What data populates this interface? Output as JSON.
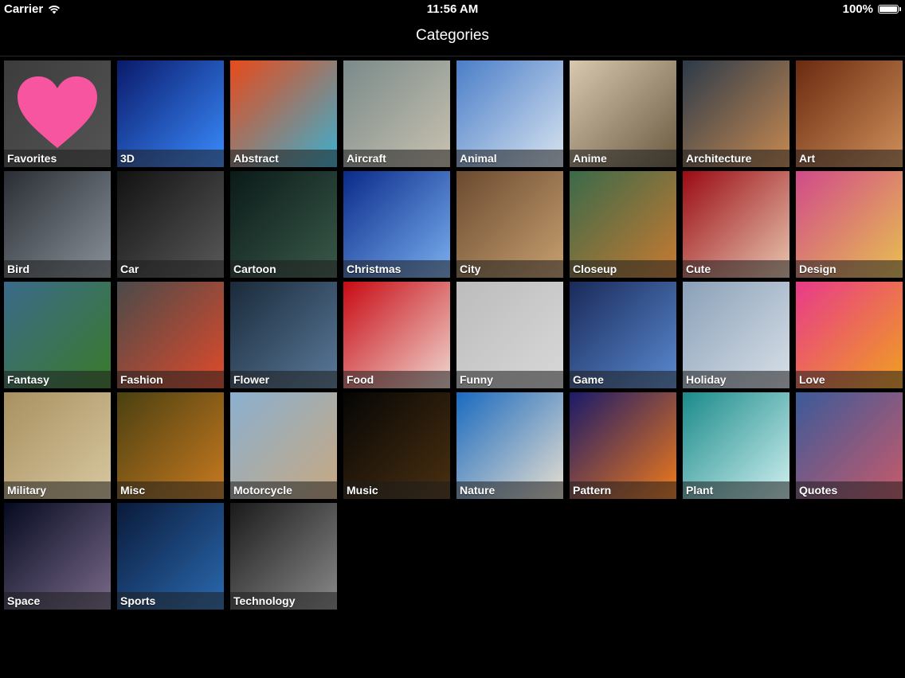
{
  "status_bar": {
    "carrier": "Carrier",
    "time": "11:56 AM",
    "battery": "100%"
  },
  "nav": {
    "title": "Categories"
  },
  "categories": [
    {
      "label": "Favorites",
      "icon": "heart-icon",
      "colors": [
        "#3c3c3c",
        "#555555"
      ]
    },
    {
      "label": "3D",
      "icon": "blue-spheres",
      "colors": [
        "#0a1a6a",
        "#3a8cff"
      ]
    },
    {
      "label": "Abstract",
      "icon": "swirl",
      "colors": [
        "#e84a1a",
        "#3ab0d0"
      ]
    },
    {
      "label": "Aircraft",
      "icon": "jet",
      "colors": [
        "#7a8a8a",
        "#c9c2b0"
      ]
    },
    {
      "label": "Animal",
      "icon": "polar-bear",
      "colors": [
        "#4a7ec8",
        "#d8e4f0"
      ]
    },
    {
      "label": "Anime",
      "icon": "anime-characters",
      "colors": [
        "#d8c8b0",
        "#6a5a40"
      ]
    },
    {
      "label": "Architecture",
      "icon": "bridge",
      "colors": [
        "#2c3a4a",
        "#c88a50"
      ]
    },
    {
      "label": "Art",
      "icon": "painting",
      "colors": [
        "#6a2a10",
        "#d0905a"
      ]
    },
    {
      "label": "Bird",
      "icon": "hawk",
      "colors": [
        "#2a2e34",
        "#8a929a"
      ]
    },
    {
      "label": "Car",
      "icon": "sports-car",
      "colors": [
        "#111111",
        "#5a5a5a"
      ]
    },
    {
      "label": "Cartoon",
      "icon": "robot-diver",
      "colors": [
        "#0a1a18",
        "#3a5a4a"
      ]
    },
    {
      "label": "Christmas",
      "icon": "ornaments",
      "colors": [
        "#0a2a8a",
        "#7ab0f0"
      ]
    },
    {
      "label": "City",
      "icon": "canal",
      "colors": [
        "#6a4a30",
        "#c8a070"
      ]
    },
    {
      "label": "Closeup",
      "icon": "flower-closeup",
      "colors": [
        "#3a6a4a",
        "#c87a30"
      ]
    },
    {
      "label": "Cute",
      "icon": "kitten",
      "colors": [
        "#9a0a14",
        "#e8c8b0"
      ]
    },
    {
      "label": "Design",
      "icon": "stripes",
      "colors": [
        "#d04a8a",
        "#e8c050"
      ]
    },
    {
      "label": "Fantasy",
      "icon": "landscape",
      "colors": [
        "#3a6a8a",
        "#3a7a2a"
      ]
    },
    {
      "label": "Fashion",
      "icon": "model",
      "colors": [
        "#4a4a4a",
        "#e04a2a"
      ]
    },
    {
      "label": "Flower",
      "icon": "snowdrop",
      "colors": [
        "#1a2a3a",
        "#5a7a9a"
      ]
    },
    {
      "label": "Food",
      "icon": "dessert",
      "colors": [
        "#c80a14",
        "#f0d8d0"
      ]
    },
    {
      "label": "Funny",
      "icon": "pacman",
      "colors": [
        "#bcbcbc",
        "#d8d8d8"
      ]
    },
    {
      "label": "Game",
      "icon": "warrior",
      "colors": [
        "#1a2a5a",
        "#5a8ad0"
      ]
    },
    {
      "label": "Holiday",
      "icon": "christmas-tree",
      "colors": [
        "#8aa0b8",
        "#d8e0e8"
      ]
    },
    {
      "label": "Love",
      "icon": "flower-heart",
      "colors": [
        "#e83a8a",
        "#f0a020"
      ]
    },
    {
      "label": "Military",
      "icon": "soldiers",
      "colors": [
        "#a89060",
        "#d8c8a0"
      ]
    },
    {
      "label": "Misc",
      "icon": "typewriter",
      "colors": [
        "#4a4010",
        "#c87a20"
      ]
    },
    {
      "label": "Motorcycle",
      "icon": "dirt-bike",
      "colors": [
        "#8ab0d0",
        "#c8a880"
      ]
    },
    {
      "label": "Music",
      "icon": "guitar",
      "colors": [
        "#050505",
        "#4a3010"
      ]
    },
    {
      "label": "Nature",
      "icon": "beach",
      "colors": [
        "#1a6ac0",
        "#e8e0d0"
      ]
    },
    {
      "label": "Pattern",
      "icon": "light-streaks",
      "colors": [
        "#1a1a6a",
        "#f07a1a"
      ]
    },
    {
      "label": "Plant",
      "icon": "dandelion",
      "colors": [
        "#1a8a8a",
        "#d0f0f0"
      ]
    },
    {
      "label": "Quotes",
      "icon": "leaf-quote",
      "colors": [
        "#3a5a9a",
        "#c85a6a"
      ]
    },
    {
      "label": "Space",
      "icon": "nebula",
      "colors": [
        "#050a20",
        "#7a6a8a"
      ]
    },
    {
      "label": "Sports",
      "icon": "soccer-player",
      "colors": [
        "#0a1a3a",
        "#2a6ab0"
      ]
    },
    {
      "label": "Technology",
      "icon": "apple-logo",
      "colors": [
        "#1a1a1a",
        "#8a8a8a"
      ]
    }
  ]
}
